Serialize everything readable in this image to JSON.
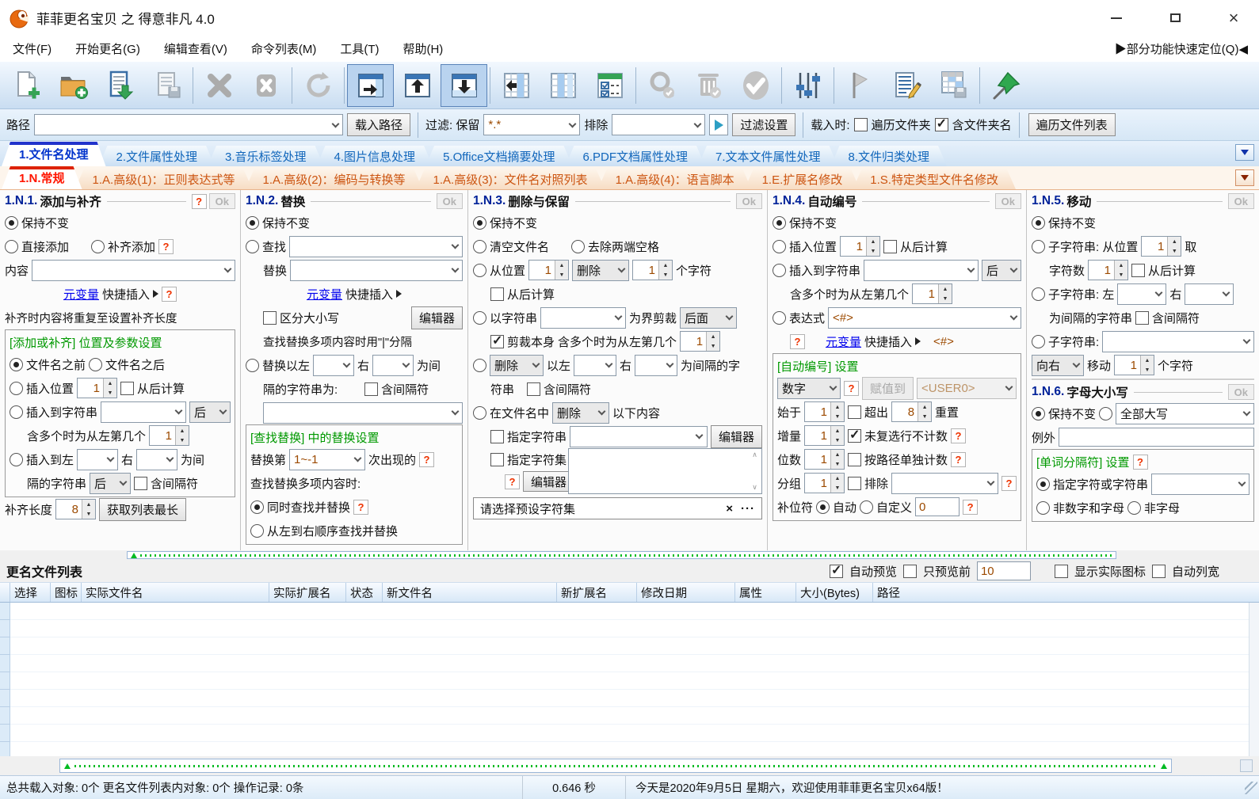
{
  "window": {
    "title": "菲菲更名宝贝 之 得意非凡 4.0",
    "quick_nav": "▶部分功能快速定位(Q)◀"
  },
  "menu": [
    "文件(F)",
    "开始更名(G)",
    "编辑查看(V)",
    "命令列表(M)",
    "工具(T)",
    "帮助(H)"
  ],
  "toolbar": {
    "buttons": [
      "new-file",
      "add-folder",
      "import-list",
      "save-list",
      "delete",
      "clear-all",
      "refresh",
      "panel-right",
      "panel-up",
      "panel-down",
      "columns-left",
      "columns-center",
      "checklist",
      "search",
      "trash",
      "confirm",
      "sliders",
      "flag",
      "edit-list",
      "table-save",
      "pin"
    ]
  },
  "pathbar": {
    "path_label": "路径",
    "load_path_btn": "载入路径",
    "filter_label": "过滤: 保留",
    "filter_value": "*.*",
    "exclude_label": "排除",
    "filter_settings_btn": "过滤设置",
    "on_load_label": "载入时:",
    "cb_traverse": "遍历文件夹",
    "cb_include_folder": "含文件夹名",
    "traverse_list_btn": "遍历文件列表"
  },
  "tabs_main": [
    "1.文件名处理",
    "2.文件属性处理",
    "3.音乐标签处理",
    "4.图片信息处理",
    "5.Office文档摘要处理",
    "6.PDF文档属性处理",
    "7.文本文件属性处理",
    "8.文件归类处理"
  ],
  "tabs_sub": [
    "1.N.常规",
    "1.A.高级(1)：正则表达式等",
    "1.A.高级(2)：编码与转换等",
    "1.A.高级(3)：文件名对照列表",
    "1.A.高级(4)：语言脚本",
    "1.E.扩展名修改",
    "1.S.特定类型文件名修改"
  ],
  "common": {
    "ok": "Ok",
    "q": "?",
    "editor": "编辑器"
  },
  "p1": {
    "num": "1.N.1.",
    "title": "添加与补齐",
    "keep": "保持不变",
    "direct_add": "直接添加",
    "pad_add": "补齐添加",
    "content_label": "内容",
    "meta_var": "元变量",
    "quick_insert": "快捷插入",
    "pad_note": "补齐时内容将重复至设置补齐长度",
    "group_title": "[添加或补齐] 位置及参数设置",
    "before_name": "文件名之前",
    "after_name": "文件名之后",
    "insert_pos": "插入位置",
    "pos_value": "1",
    "from_end": "从后计算",
    "insert_to_str": "插入到字符串",
    "after_opt": "后",
    "multi_note": "含多个时为从左第几个",
    "multi_value": "1",
    "insert_between": "插入到左",
    "right_label": "右",
    "between_suffix": "为间",
    "sep_str": "隔的字符串",
    "incl_sep": "含间隔符",
    "pad_len_label": "补齐长度",
    "pad_len": "8",
    "get_longest": "获取列表最长"
  },
  "p2": {
    "num": "1.N.2.",
    "title": "替换",
    "keep": "保持不变",
    "find": "查找",
    "replace": "替换",
    "meta_var": "元变量",
    "quick_insert": "快捷插入",
    "case_sensitive": "区分大小写",
    "multi_note": "查找替换多项内容时用\"|\"分隔",
    "between": "替换以左",
    "right_label": "右",
    "between_suffix": "为间",
    "sep_str": "隔的字符串为:",
    "incl_sep": "含间隔符",
    "group_title": "[查找替换] 中的替换设置",
    "replace_nth": "替换第",
    "nth_value": "1~-1",
    "nth_suffix": "次出现的",
    "multi_mode": "查找替换多项内容时:",
    "simultaneous": "同时查找并替换",
    "sequential": "从左到右顺序查找并替换"
  },
  "p3": {
    "num": "1.N.3.",
    "title": "删除与保留",
    "keep": "保持不变",
    "clear_name": "清空文件名",
    "trim": "去除两端空格",
    "from_pos": "从位置",
    "pos": "1",
    "del_opt": "删除",
    "count": "1",
    "chars_suffix": "个字符",
    "from_end": "从后计算",
    "by_str": "以字符串",
    "cut_label": "为界剪裁",
    "cut_side": "后面",
    "cut_self": "剪裁本身",
    "multi_note": "含多个时为从左第几个",
    "multi_val": "1",
    "del2": "删除",
    "between_left": "以左",
    "right_label": "右",
    "between_suffix": "为间隔的字",
    "str_suffix": "符串",
    "incl_sep": "含间隔符",
    "in_name": "在文件名中",
    "del3": "删除",
    "following": "以下内容",
    "spec_str": "指定字符串",
    "spec_set": "指定字符集",
    "preset": "请选择预设字符集",
    "clear_x": "×",
    "more": "···"
  },
  "p4": {
    "num": "1.N.4.",
    "title": "自动编号",
    "keep": "保持不变",
    "insert_pos": "插入位置",
    "pos": "1",
    "from_end": "从后计算",
    "insert_to": "插入到字符串",
    "after_opt": "后",
    "multi_note": "含多个时为从左第几个",
    "multi_val": "1",
    "expr": "表达式",
    "expr_val": "<#>",
    "meta_var": "元变量",
    "quick_insert": "快捷插入",
    "expr_hint": "<#>",
    "group_title": "[自动编号] 设置",
    "type_val": "数字",
    "assign_btn": "赋值到",
    "assign_val": "<USER0>",
    "start": "始于",
    "start_val": "1",
    "over": "超出",
    "over_val": "8",
    "reset": "重置",
    "inc": "增量",
    "inc_val": "1",
    "no_count": "未复选行不计数",
    "digits": "位数",
    "digits_val": "1",
    "per_path": "按路径单独计数",
    "grouping": "分组",
    "group_val": "1",
    "exclude": "排除",
    "pad": "补位符",
    "auto": "自动",
    "custom": "自定义",
    "custom_val": "0"
  },
  "p5": {
    "num": "1.N.5.",
    "title": "移动",
    "keep": "保持不变",
    "sub1": "子字符串: 从位置",
    "pos": "1",
    "take": "取",
    "chars": "字符数",
    "chars_val": "1",
    "from_end": "从后计算",
    "sub2": "子字符串: 左",
    "right_label": "右",
    "sep_note": "为间隔的字符串",
    "incl_sep": "含间隔符",
    "sub3": "子字符串:",
    "dir": "向右",
    "move": "移动",
    "move_val": "1",
    "chars_suffix": "个字符"
  },
  "p6": {
    "num": "1.N.6.",
    "title": "字母大小写",
    "keep": "保持不变",
    "case_val": "全部大写",
    "except": "例外",
    "group_title": "[单词分隔符] 设置",
    "spec": "指定字符或字符串",
    "non_alnum": "非数字和字母",
    "non_alpha": "非字母"
  },
  "list": {
    "caption": "更名文件列表",
    "auto_preview": "自动预览",
    "preview_first": "只预览前",
    "preview_count": "10",
    "show_icon": "显示实际图标",
    "auto_width": "自动列宽",
    "columns": [
      "选择",
      "图标",
      "实际文件名",
      "实际扩展名",
      "状态",
      "新文件名",
      "新扩展名",
      "修改日期",
      "属性",
      "大小(Bytes)",
      "路径"
    ]
  },
  "statusbar": {
    "counts": "总共载入对象: 0个  更名文件列表内对象: 0个  操作记录: 0条",
    "time": "0.646 秒",
    "greeting": "今天是2020年9月5日 星期六，欢迎使用菲菲更名宝贝x64版！"
  }
}
